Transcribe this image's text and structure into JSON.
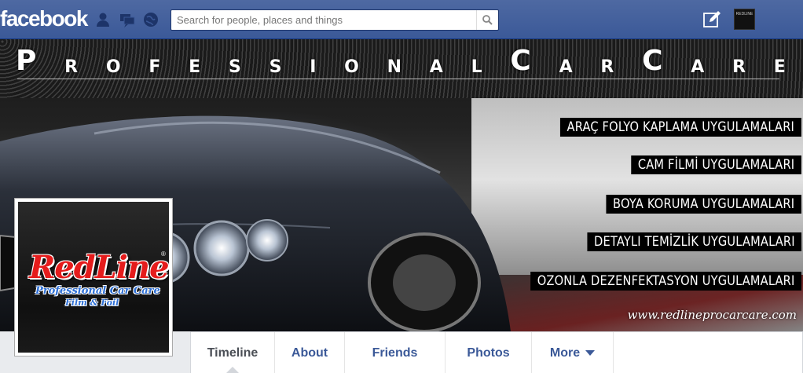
{
  "header": {
    "logo": "facebook",
    "search_placeholder": "Search for people, places and things",
    "icons": [
      "friend-requests-icon",
      "messages-icon",
      "notifications-icon",
      "search-icon",
      "compose-icon"
    ],
    "brand_color": "#3b5998"
  },
  "cover": {
    "title_words": [
      "P",
      "R",
      "O",
      "F",
      "E",
      "S",
      "S",
      "I",
      "O",
      "N",
      "A",
      "L",
      "C",
      "A",
      "R",
      "C",
      "A",
      "R",
      "E"
    ],
    "services": [
      "ARAÇ FOLYO KAPLAMA UYGULAMALARI",
      "CAM FİLMİ UYGULAMALARI",
      "BOYA KORUMA UYGULAMALARI",
      "DETAYLI TEMİZLİK UYGULAMALARI",
      "OZONLA DEZENFEKTASYON UYGULAMALARI"
    ],
    "website": "www.redlineprocarcare.com"
  },
  "profile": {
    "logo_text": "RedLine",
    "subtitle_1": "Professional Car Care",
    "subtitle_2": "Film & Foil",
    "logo_color": "#e51c1c",
    "subtitle_color": "#2d6fd6"
  },
  "tabs": [
    {
      "label": "Timeline",
      "active": true
    },
    {
      "label": "About"
    },
    {
      "label": "Friends"
    },
    {
      "label": "Photos"
    },
    {
      "label": "More"
    }
  ]
}
